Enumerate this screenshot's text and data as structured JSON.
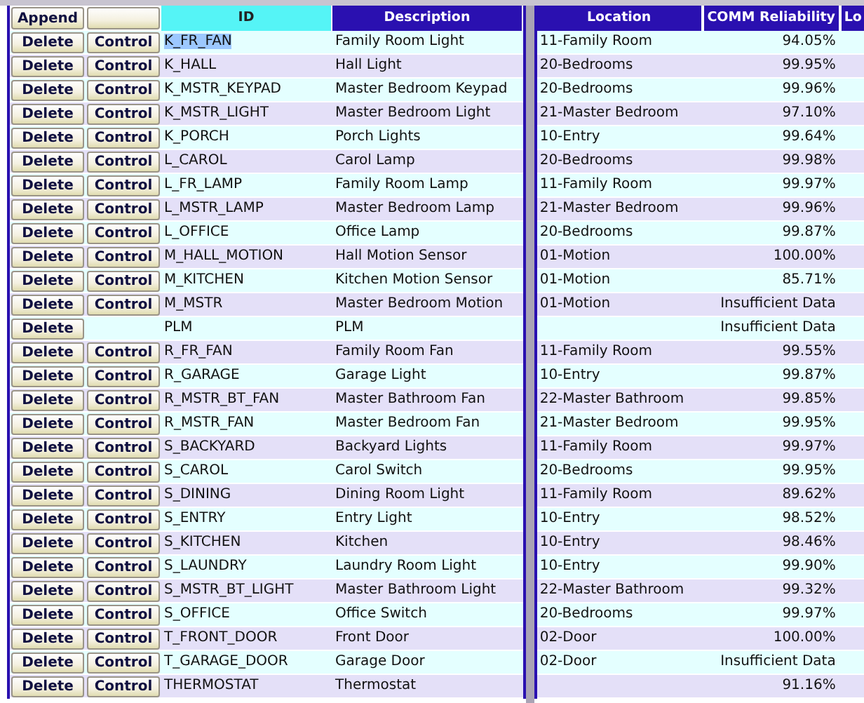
{
  "left_header": {
    "buttons": [
      {
        "kind": "append",
        "label": "Append"
      },
      {
        "kind": "blank"
      }
    ],
    "columns": [
      {
        "label": "ID",
        "sorted": true
      },
      {
        "label": "Description",
        "sorted": false
      }
    ]
  },
  "right_header": {
    "columns": [
      {
        "label": "Location",
        "sorted": false
      },
      {
        "label": "COMM Reliability",
        "sorted": false
      },
      {
        "label": "Lo",
        "sorted": false
      }
    ]
  },
  "rows": [
    {
      "delete_label": "Delete",
      "control_label": "Control",
      "id": "K_FR_FAN",
      "description": "Family Room Light",
      "location": "11-Family Room",
      "reliability": "94.05%",
      "has_control": true,
      "selected": true
    },
    {
      "delete_label": "Delete",
      "control_label": "Control",
      "id": "K_HALL",
      "description": "Hall Light",
      "location": "20-Bedrooms",
      "reliability": "99.95%",
      "has_control": true,
      "selected": false
    },
    {
      "delete_label": "Delete",
      "control_label": "Control",
      "id": "K_MSTR_KEYPAD",
      "description": "Master Bedroom Keypad",
      "location": "20-Bedrooms",
      "reliability": "99.96%",
      "has_control": true,
      "selected": false
    },
    {
      "delete_label": "Delete",
      "control_label": "Control",
      "id": "K_MSTR_LIGHT",
      "description": "Master Bedroom Light",
      "location": "21-Master Bedroom",
      "reliability": "97.10%",
      "has_control": true,
      "selected": false
    },
    {
      "delete_label": "Delete",
      "control_label": "Control",
      "id": "K_PORCH",
      "description": "Porch Lights",
      "location": "10-Entry",
      "reliability": "99.64%",
      "has_control": true,
      "selected": false
    },
    {
      "delete_label": "Delete",
      "control_label": "Control",
      "id": "L_CAROL",
      "description": "Carol Lamp",
      "location": "20-Bedrooms",
      "reliability": "99.98%",
      "has_control": true,
      "selected": false
    },
    {
      "delete_label": "Delete",
      "control_label": "Control",
      "id": "L_FR_LAMP",
      "description": "Family Room Lamp",
      "location": "11-Family Room",
      "reliability": "99.97%",
      "has_control": true,
      "selected": false
    },
    {
      "delete_label": "Delete",
      "control_label": "Control",
      "id": "L_MSTR_LAMP",
      "description": "Master Bedroom Lamp",
      "location": "21-Master Bedroom",
      "reliability": "99.96%",
      "has_control": true,
      "selected": false
    },
    {
      "delete_label": "Delete",
      "control_label": "Control",
      "id": "L_OFFICE",
      "description": "Office Lamp",
      "location": "20-Bedrooms",
      "reliability": "99.87%",
      "has_control": true,
      "selected": false
    },
    {
      "delete_label": "Delete",
      "control_label": "Control",
      "id": "M_HALL_MOTION",
      "description": "Hall Motion Sensor",
      "location": "01-Motion",
      "reliability": "100.00%",
      "has_control": true,
      "selected": false
    },
    {
      "delete_label": "Delete",
      "control_label": "Control",
      "id": "M_KITCHEN",
      "description": "Kitchen Motion Sensor",
      "location": "01-Motion",
      "reliability": "85.71%",
      "has_control": true,
      "selected": false
    },
    {
      "delete_label": "Delete",
      "control_label": "Control",
      "id": "M_MSTR",
      "description": "Master Bedroom Motion",
      "location": "01-Motion",
      "reliability": "Insufficient Data",
      "has_control": true,
      "selected": false
    },
    {
      "delete_label": "Delete",
      "id": "PLM",
      "description": "PLM",
      "reliability": "Insufficient Data",
      "has_control": false,
      "selected": false
    },
    {
      "delete_label": "Delete",
      "control_label": "Control",
      "id": "R_FR_FAN",
      "description": "Family Room Fan",
      "location": "11-Family Room",
      "reliability": "99.55%",
      "has_control": true,
      "selected": false
    },
    {
      "delete_label": "Delete",
      "control_label": "Control",
      "id": "R_GARAGE",
      "description": "Garage Light",
      "location": "10-Entry",
      "reliability": "99.87%",
      "has_control": true,
      "selected": false
    },
    {
      "delete_label": "Delete",
      "control_label": "Control",
      "id": "R_MSTR_BT_FAN",
      "description": "Master Bathroom Fan",
      "location": "22-Master Bathroom",
      "reliability": "99.85%",
      "has_control": true,
      "selected": false
    },
    {
      "delete_label": "Delete",
      "control_label": "Control",
      "id": "R_MSTR_FAN",
      "description": "Master Bedroom Fan",
      "location": "21-Master Bedroom",
      "reliability": "99.95%",
      "has_control": true,
      "selected": false
    },
    {
      "delete_label": "Delete",
      "control_label": "Control",
      "id": "S_BACKYARD",
      "description": "Backyard Lights",
      "location": "11-Family Room",
      "reliability": "99.97%",
      "has_control": true,
      "selected": false
    },
    {
      "delete_label": "Delete",
      "control_label": "Control",
      "id": "S_CAROL",
      "description": "Carol Switch",
      "location": "20-Bedrooms",
      "reliability": "99.95%",
      "has_control": true,
      "selected": false
    },
    {
      "delete_label": "Delete",
      "control_label": "Control",
      "id": "S_DINING",
      "description": "Dining Room Light",
      "location": "11-Family Room",
      "reliability": "89.62%",
      "has_control": true,
      "selected": false
    },
    {
      "delete_label": "Delete",
      "control_label": "Control",
      "id": "S_ENTRY",
      "description": "Entry Light",
      "location": "10-Entry",
      "reliability": "98.52%",
      "has_control": true,
      "selected": false
    },
    {
      "delete_label": "Delete",
      "control_label": "Control",
      "id": "S_KITCHEN",
      "description": "Kitchen",
      "location": "10-Entry",
      "reliability": "98.46%",
      "has_control": true,
      "selected": false
    },
    {
      "delete_label": "Delete",
      "control_label": "Control",
      "id": "S_LAUNDRY",
      "description": "Laundry Room Light",
      "location": "10-Entry",
      "reliability": "99.90%",
      "has_control": true,
      "selected": false
    },
    {
      "delete_label": "Delete",
      "control_label": "Control",
      "id": "S_MSTR_BT_LIGHT",
      "description": "Master Bathroom Light",
      "location": "22-Master Bathroom",
      "reliability": "99.32%",
      "has_control": true,
      "selected": false
    },
    {
      "delete_label": "Delete",
      "control_label": "Control",
      "id": "S_OFFICE",
      "description": "Office Switch",
      "location": "20-Bedrooms",
      "reliability": "99.97%",
      "has_control": true,
      "selected": false
    },
    {
      "delete_label": "Delete",
      "control_label": "Control",
      "id": "T_FRONT_DOOR",
      "description": "Front Door",
      "location": "02-Door",
      "reliability": "100.00%",
      "has_control": true,
      "selected": false
    },
    {
      "delete_label": "Delete",
      "control_label": "Control",
      "id": "T_GARAGE_DOOR",
      "description": "Garage Door",
      "location": "02-Door",
      "reliability": "Insufficient Data",
      "has_control": true,
      "selected": false
    },
    {
      "delete_label": "Delete",
      "control_label": "Control",
      "id": "THERMOSTAT",
      "description": "Thermostat",
      "reliability": "91.16%",
      "has_control": true,
      "selected": false
    }
  ]
}
